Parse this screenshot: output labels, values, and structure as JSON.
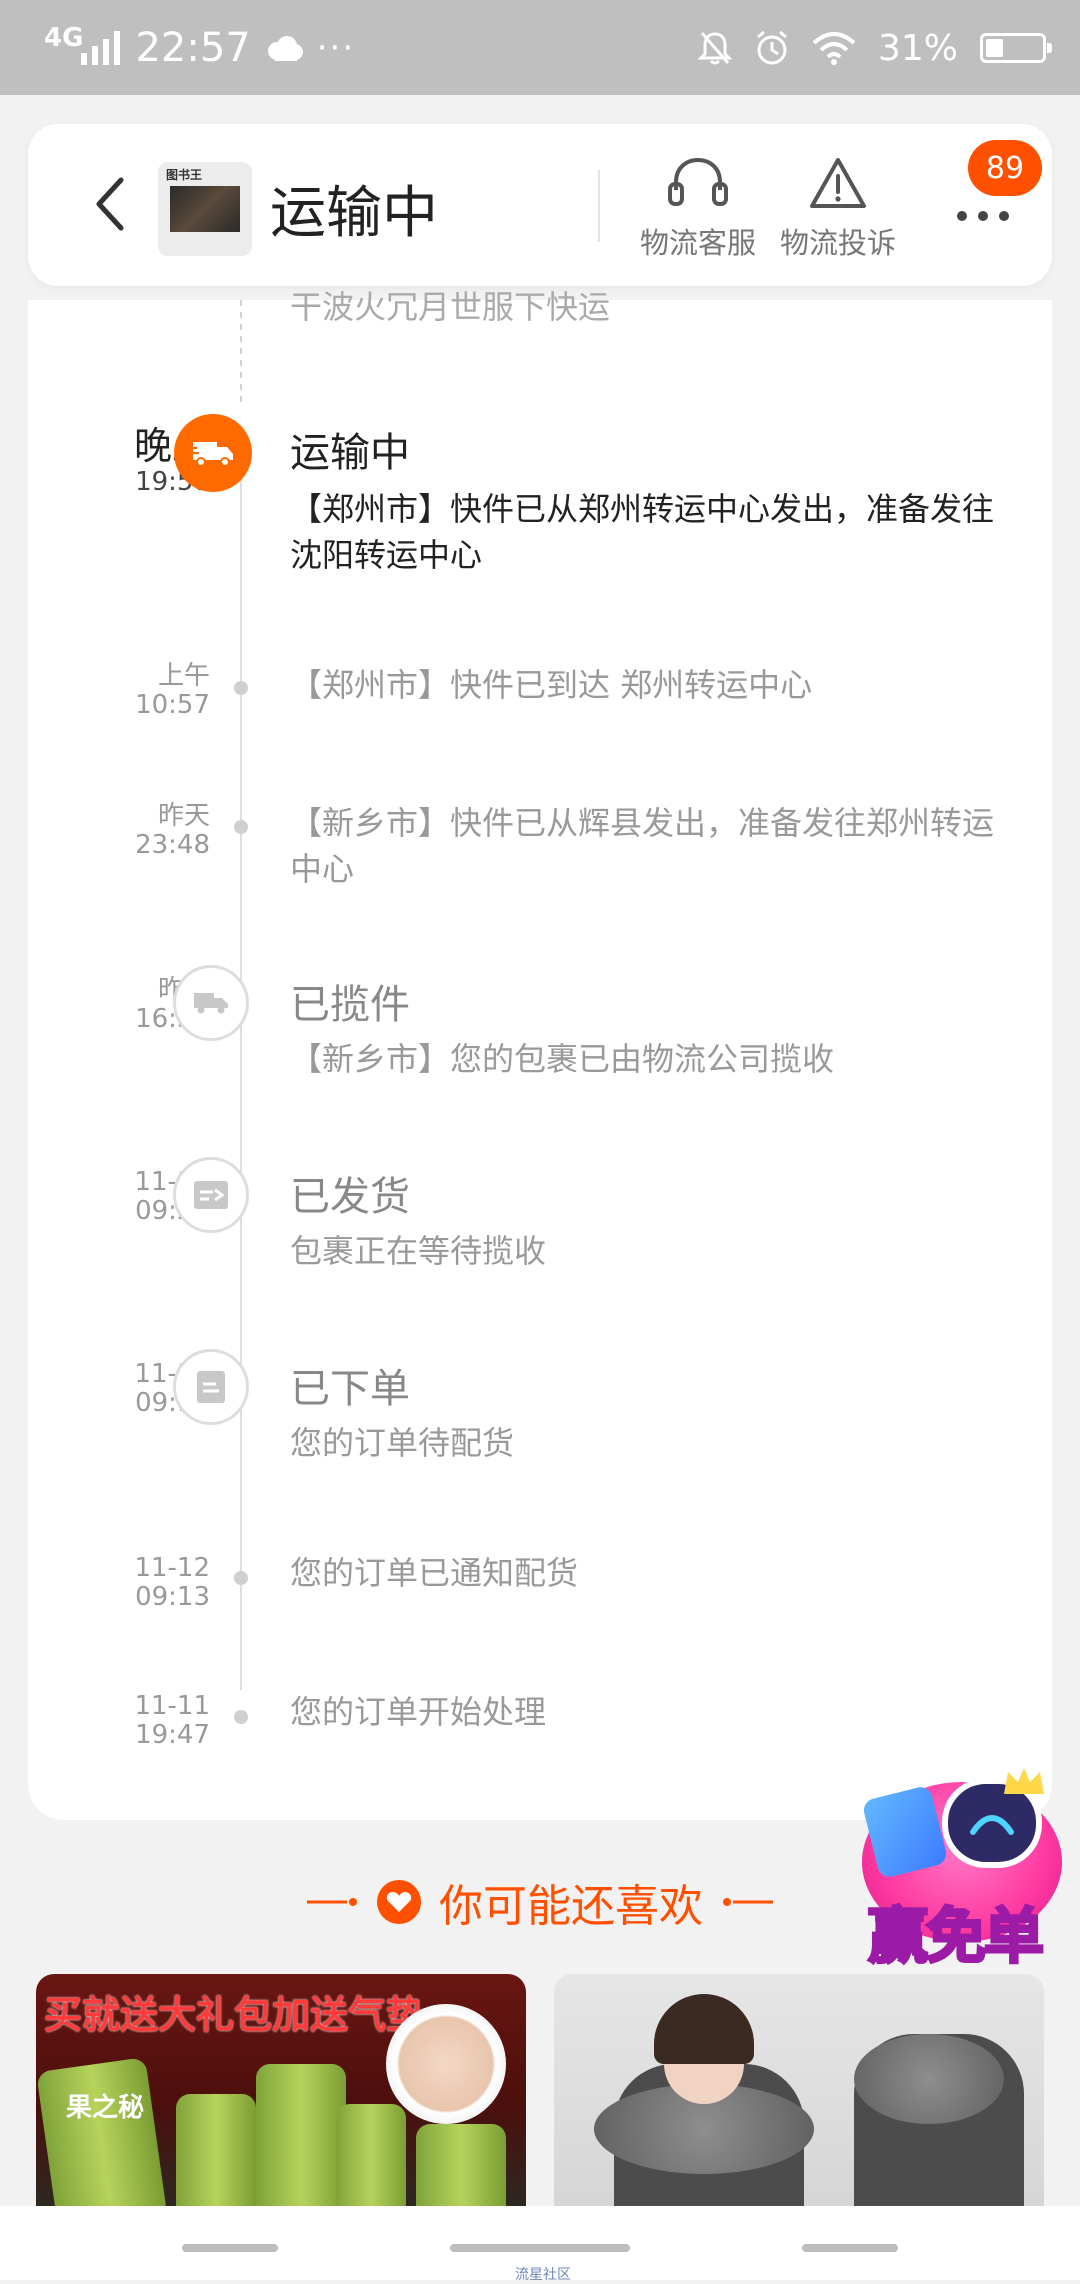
{
  "status_bar": {
    "network": "4G",
    "time": "22:57",
    "more": "···",
    "battery": "31%",
    "battery_level": 0.31
  },
  "header": {
    "title": "运输中",
    "thumb_label": "图书王",
    "actions": [
      {
        "label": "物流客服",
        "icon": "headset-icon"
      },
      {
        "label": "物流投诉",
        "icon": "warning-icon"
      }
    ],
    "badge": "89"
  },
  "timeline": {
    "clipped_text": "干波火冗月世服下快运",
    "events": [
      {
        "time_top": "晚上",
        "time_bottom": "19:58",
        "status": "运输中",
        "desc": "【郑州市】快件已从郑州转运中心发出，准备发往沈阳转运中心",
        "node": "truck-active",
        "active": true
      },
      {
        "time_top": "上午",
        "time_bottom": "10:57",
        "status": "",
        "desc": "【郑州市】快件已到达 郑州转运中心",
        "node": "dot"
      },
      {
        "time_top": "昨天",
        "time_bottom": "23:48",
        "status": "",
        "desc": "【新乡市】快件已从辉县发出，准备发往郑州转运中心",
        "node": "dot"
      },
      {
        "time_top": "昨天",
        "time_bottom": "16:34",
        "status": "已揽件",
        "desc": "【新乡市】您的包裹已由物流公司揽收",
        "node": "truck"
      },
      {
        "time_top": "11-12",
        "time_bottom": "09:22",
        "status": "已发货",
        "desc": "包裹正在等待揽收",
        "node": "ship"
      },
      {
        "time_top": "11-12",
        "time_bottom": "09:13",
        "status": "已下单",
        "desc": "您的订单待配货",
        "node": "doc"
      },
      {
        "time_top": "11-12",
        "time_bottom": "09:13",
        "status": "",
        "desc": "您的订单已通知配货",
        "node": "dot"
      },
      {
        "time_top": "11-11",
        "time_bottom": "19:47",
        "status": "",
        "desc": "您的订单开始处理",
        "node": "dot"
      }
    ]
  },
  "recommend": {
    "title": "你可能还喜欢",
    "products": [
      {
        "promo": "买就送大礼包加送气垫",
        "brand": "果之秘"
      },
      {
        "promo": ""
      }
    ]
  },
  "float_promo": {
    "label": "赢免单"
  },
  "bottom_nav": {
    "caption": "流星社区"
  },
  "colors": {
    "accent": "#ff5000",
    "node_active": "#ff6a00",
    "status_bar": "#bfbfbf"
  }
}
